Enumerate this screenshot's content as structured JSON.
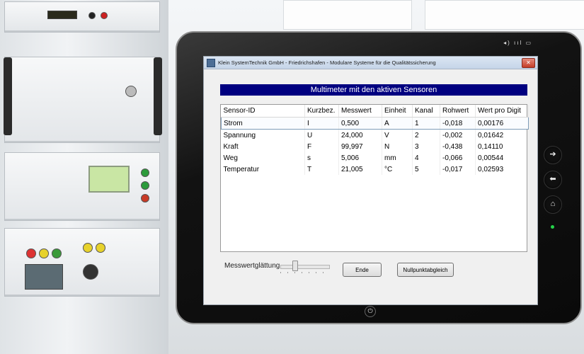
{
  "window": {
    "title": "Klein SystemTechnik GmbH - Friedrichshafen - Modulare Systeme für die Qualitätssicherung",
    "close_glyph": "✕"
  },
  "tablet": {
    "status_icons": [
      "volume-icon",
      "signal-icon",
      "battery-icon"
    ],
    "status_text": "◂) ııl ▭",
    "side_buttons": [
      {
        "name": "forward-button",
        "icon": "arrow-right-icon",
        "glyph": "➔"
      },
      {
        "name": "back-button",
        "icon": "arrow-left-icon",
        "glyph": "⬅"
      },
      {
        "name": "home-button",
        "icon": "home-icon",
        "glyph": "⌂"
      }
    ],
    "power_glyph": "⏻",
    "led_color": "#25d24a"
  },
  "main": {
    "heading": "Multimeter mit den aktiven Sensoren",
    "heading_color": "#000080",
    "table": {
      "columns": [
        "Sensor-ID",
        "Kurzbez.",
        "Messwert",
        "Einheit",
        "Kanal",
        "Rohwert",
        "Wert pro Digit"
      ],
      "rows": [
        [
          "Strom",
          "I",
          "0,500",
          "A",
          "1",
          "-0,018",
          "0,00176"
        ],
        [
          "Spannung",
          "U",
          "24,000",
          "V",
          "2",
          "-0,002",
          "0,01642"
        ],
        [
          "Kraft",
          "F",
          "99,997",
          "N",
          "3",
          "-0,438",
          "0,14110"
        ],
        [
          "Weg",
          "s",
          "5,006",
          "mm",
          "4",
          "-0,066",
          "0,00544"
        ],
        [
          "Temperatur",
          "T",
          "21,005",
          "°C",
          "5",
          "-0,017",
          "0,02593"
        ]
      ],
      "selected_row": 0
    },
    "smoothing": {
      "label": "Messwertglättung",
      "slider_value": 0.25
    },
    "buttons": {
      "end": "Ende",
      "zero": "Nullpunktabgleich"
    }
  }
}
